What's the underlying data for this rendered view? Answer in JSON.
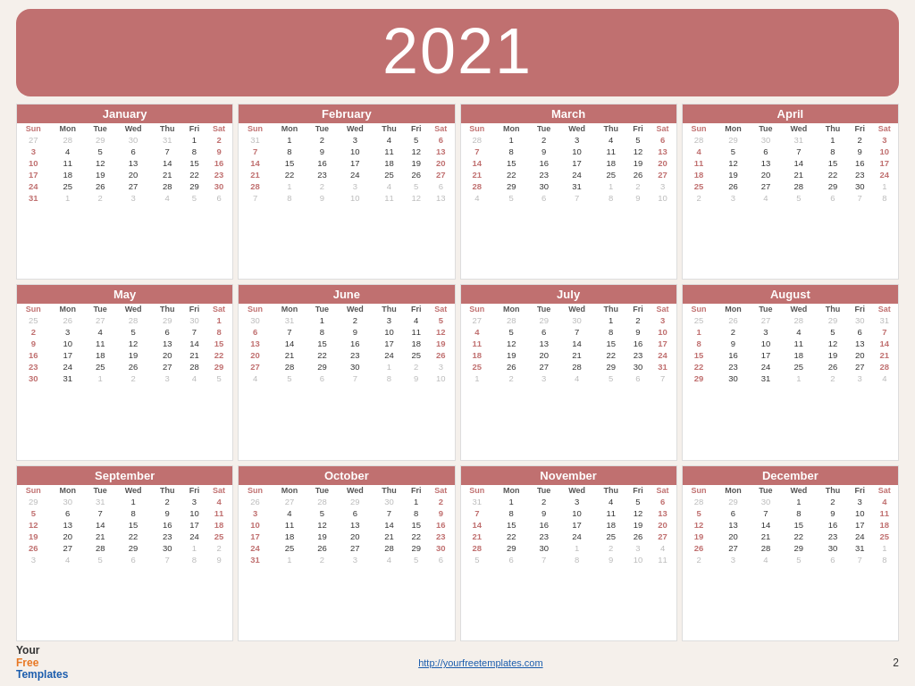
{
  "year": "2021",
  "footer": {
    "url": "http://yourfreetemplates.com",
    "page": "2"
  },
  "months": [
    {
      "name": "January",
      "weeks": [
        [
          "27",
          "28",
          "29",
          "30",
          "31",
          "1",
          "2"
        ],
        [
          "3",
          "4",
          "5",
          "6",
          "7",
          "8",
          "9"
        ],
        [
          "10",
          "11",
          "12",
          "13",
          "14",
          "15",
          "16"
        ],
        [
          "17",
          "18",
          "19",
          "20",
          "21",
          "22",
          "23"
        ],
        [
          "24",
          "25",
          "26",
          "27",
          "28",
          "29",
          "30"
        ],
        [
          "31",
          "1",
          "2",
          "3",
          "4",
          "5",
          "6"
        ]
      ],
      "otherMonth": {
        "0": [
          0,
          1,
          2,
          3,
          4
        ],
        "5": [
          1,
          2,
          3,
          4,
          5,
          6
        ]
      }
    },
    {
      "name": "February",
      "weeks": [
        [
          "31",
          "1",
          "2",
          "3",
          "4",
          "5",
          "6"
        ],
        [
          "7",
          "8",
          "9",
          "10",
          "11",
          "12",
          "13"
        ],
        [
          "14",
          "15",
          "16",
          "17",
          "18",
          "19",
          "20"
        ],
        [
          "21",
          "22",
          "23",
          "24",
          "25",
          "26",
          "27"
        ],
        [
          "28",
          "1",
          "2",
          "3",
          "4",
          "5",
          "6"
        ],
        [
          "7",
          "8",
          "9",
          "10",
          "11",
          "12",
          "13"
        ]
      ],
      "otherMonth": {
        "0": [
          0
        ],
        "4": [
          1,
          2,
          3,
          4,
          5,
          6
        ],
        "5": [
          0,
          1,
          2,
          3,
          4,
          5,
          6
        ]
      }
    },
    {
      "name": "March",
      "weeks": [
        [
          "28",
          "1",
          "2",
          "3",
          "4",
          "5",
          "6"
        ],
        [
          "7",
          "8",
          "9",
          "10",
          "11",
          "12",
          "13"
        ],
        [
          "14",
          "15",
          "16",
          "17",
          "18",
          "19",
          "20"
        ],
        [
          "21",
          "22",
          "23",
          "24",
          "25",
          "26",
          "27"
        ],
        [
          "28",
          "29",
          "30",
          "31",
          "1",
          "2",
          "3"
        ],
        [
          "4",
          "5",
          "6",
          "7",
          "8",
          "9",
          "10"
        ]
      ],
      "otherMonth": {
        "0": [
          0
        ],
        "4": [
          4,
          5,
          6
        ],
        "5": [
          0,
          1,
          2,
          3,
          4,
          5,
          6
        ]
      }
    },
    {
      "name": "April",
      "weeks": [
        [
          "28",
          "29",
          "30",
          "31",
          "1",
          "2",
          "3"
        ],
        [
          "4",
          "5",
          "6",
          "7",
          "8",
          "9",
          "10"
        ],
        [
          "11",
          "12",
          "13",
          "14",
          "15",
          "16",
          "17"
        ],
        [
          "18",
          "19",
          "20",
          "21",
          "22",
          "23",
          "24"
        ],
        [
          "25",
          "26",
          "27",
          "28",
          "29",
          "30",
          "1"
        ],
        [
          "2",
          "3",
          "4",
          "5",
          "6",
          "7",
          "8"
        ]
      ],
      "otherMonth": {
        "0": [
          0,
          1,
          2,
          3
        ],
        "4": [
          6
        ],
        "5": [
          0,
          1,
          2,
          3,
          4,
          5,
          6
        ]
      }
    },
    {
      "name": "May",
      "weeks": [
        [
          "25",
          "26",
          "27",
          "28",
          "29",
          "30",
          "1"
        ],
        [
          "2",
          "3",
          "4",
          "5",
          "6",
          "7",
          "8"
        ],
        [
          "9",
          "10",
          "11",
          "12",
          "13",
          "14",
          "15"
        ],
        [
          "16",
          "17",
          "18",
          "19",
          "20",
          "21",
          "22"
        ],
        [
          "23",
          "24",
          "25",
          "26",
          "27",
          "28",
          "29"
        ],
        [
          "30",
          "31",
          "1",
          "2",
          "3",
          "4",
          "5"
        ]
      ],
      "otherMonth": {
        "0": [
          0,
          1,
          2,
          3,
          4,
          5
        ],
        "5": [
          2,
          3,
          4,
          5,
          6
        ]
      }
    },
    {
      "name": "June",
      "weeks": [
        [
          "30",
          "31",
          "1",
          "2",
          "3",
          "4",
          "5"
        ],
        [
          "6",
          "7",
          "8",
          "9",
          "10",
          "11",
          "12"
        ],
        [
          "13",
          "14",
          "15",
          "16",
          "17",
          "18",
          "19"
        ],
        [
          "20",
          "21",
          "22",
          "23",
          "24",
          "25",
          "26"
        ],
        [
          "27",
          "28",
          "29",
          "30",
          "1",
          "2",
          "3"
        ],
        [
          "4",
          "5",
          "6",
          "7",
          "8",
          "9",
          "10"
        ]
      ],
      "otherMonth": {
        "0": [
          0,
          1
        ],
        "4": [
          4,
          5,
          6
        ],
        "5": [
          0,
          1,
          2,
          3,
          4,
          5,
          6
        ]
      }
    },
    {
      "name": "July",
      "weeks": [
        [
          "27",
          "28",
          "29",
          "30",
          "1",
          "2",
          "3"
        ],
        [
          "4",
          "5",
          "6",
          "7",
          "8",
          "9",
          "10"
        ],
        [
          "11",
          "12",
          "13",
          "14",
          "15",
          "16",
          "17"
        ],
        [
          "18",
          "19",
          "20",
          "21",
          "22",
          "23",
          "24"
        ],
        [
          "25",
          "26",
          "27",
          "28",
          "29",
          "30",
          "31"
        ],
        [
          "1",
          "2",
          "3",
          "4",
          "5",
          "6",
          "7"
        ]
      ],
      "otherMonth": {
        "0": [
          0,
          1,
          2,
          3
        ],
        "5": [
          0,
          1,
          2,
          3,
          4,
          5,
          6
        ]
      }
    },
    {
      "name": "August",
      "weeks": [
        [
          "25",
          "26",
          "27",
          "28",
          "29",
          "30",
          "31"
        ],
        [
          "1",
          "2",
          "3",
          "4",
          "5",
          "6",
          "7"
        ],
        [
          "8",
          "9",
          "10",
          "11",
          "12",
          "13",
          "14"
        ],
        [
          "15",
          "16",
          "17",
          "18",
          "19",
          "20",
          "21"
        ],
        [
          "22",
          "23",
          "24",
          "25",
          "26",
          "27",
          "28"
        ],
        [
          "29",
          "30",
          "31",
          "1",
          "2",
          "3",
          "4"
        ]
      ],
      "otherMonth": {
        "0": [
          0,
          1,
          2,
          3,
          4,
          5,
          6
        ],
        "5": [
          3,
          4,
          5,
          6
        ]
      }
    },
    {
      "name": "September",
      "weeks": [
        [
          "29",
          "30",
          "31",
          "1",
          "2",
          "3",
          "4"
        ],
        [
          "5",
          "6",
          "7",
          "8",
          "9",
          "10",
          "11"
        ],
        [
          "12",
          "13",
          "14",
          "15",
          "16",
          "17",
          "18"
        ],
        [
          "19",
          "20",
          "21",
          "22",
          "23",
          "24",
          "25"
        ],
        [
          "26",
          "27",
          "28",
          "29",
          "30",
          "1",
          "2"
        ],
        [
          "3",
          "4",
          "5",
          "6",
          "7",
          "8",
          "9"
        ]
      ],
      "otherMonth": {
        "0": [
          0,
          1,
          2
        ],
        "4": [
          5,
          6
        ],
        "5": [
          0,
          1,
          2,
          3,
          4,
          5,
          6
        ]
      }
    },
    {
      "name": "October",
      "weeks": [
        [
          "26",
          "27",
          "28",
          "29",
          "30",
          "1",
          "2"
        ],
        [
          "3",
          "4",
          "5",
          "6",
          "7",
          "8",
          "9"
        ],
        [
          "10",
          "11",
          "12",
          "13",
          "14",
          "15",
          "16"
        ],
        [
          "17",
          "18",
          "19",
          "20",
          "21",
          "22",
          "23"
        ],
        [
          "24",
          "25",
          "26",
          "27",
          "28",
          "29",
          "30"
        ],
        [
          "31",
          "1",
          "2",
          "3",
          "4",
          "5",
          "6"
        ]
      ],
      "otherMonth": {
        "0": [
          0,
          1,
          2,
          3,
          4
        ],
        "5": [
          1,
          2,
          3,
          4,
          5,
          6
        ]
      }
    },
    {
      "name": "November",
      "weeks": [
        [
          "31",
          "1",
          "2",
          "3",
          "4",
          "5",
          "6"
        ],
        [
          "7",
          "8",
          "9",
          "10",
          "11",
          "12",
          "13"
        ],
        [
          "14",
          "15",
          "16",
          "17",
          "18",
          "19",
          "20"
        ],
        [
          "21",
          "22",
          "23",
          "24",
          "25",
          "26",
          "27"
        ],
        [
          "28",
          "29",
          "30",
          "1",
          "2",
          "3",
          "4"
        ],
        [
          "5",
          "6",
          "7",
          "8",
          "9",
          "10",
          "11"
        ]
      ],
      "otherMonth": {
        "0": [
          0
        ],
        "4": [
          3,
          4,
          5,
          6
        ],
        "5": [
          0,
          1,
          2,
          3,
          4,
          5,
          6
        ]
      }
    },
    {
      "name": "December",
      "weeks": [
        [
          "28",
          "29",
          "30",
          "1",
          "2",
          "3",
          "4"
        ],
        [
          "5",
          "6",
          "7",
          "8",
          "9",
          "10",
          "11"
        ],
        [
          "12",
          "13",
          "14",
          "15",
          "16",
          "17",
          "18"
        ],
        [
          "19",
          "20",
          "21",
          "22",
          "23",
          "24",
          "25"
        ],
        [
          "26",
          "27",
          "28",
          "29",
          "30",
          "31",
          "1"
        ],
        [
          "2",
          "3",
          "4",
          "5",
          "6",
          "7",
          "8"
        ]
      ],
      "otherMonth": {
        "0": [
          0,
          1,
          2
        ],
        "4": [
          6
        ],
        "5": [
          0,
          1,
          2,
          3,
          4,
          5,
          6
        ]
      }
    }
  ],
  "dayHeaders": [
    "Sun",
    "Mon",
    "Tue",
    "Wed",
    "Thu",
    "Fri",
    "Sat"
  ]
}
